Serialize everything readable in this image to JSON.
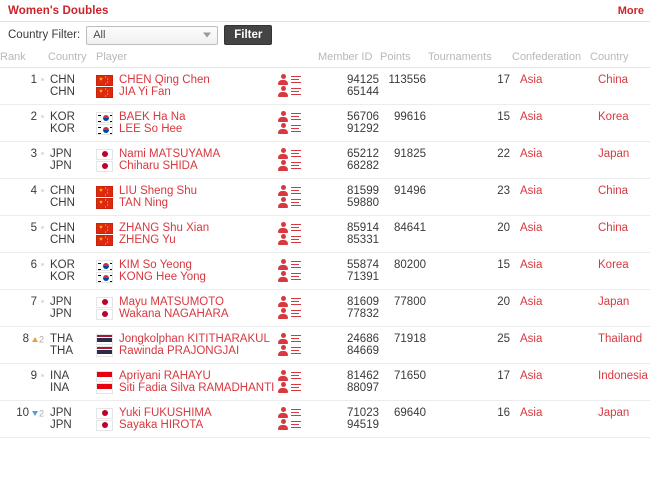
{
  "header": {
    "title": "Women's Doubles",
    "more_label": "More"
  },
  "filter": {
    "label": "Country Filter:",
    "selected_value": "All",
    "button_label": "Filter",
    "caret_icon": "chevron-down-icon"
  },
  "columns": {
    "rank": "Rank",
    "country": "Country",
    "player": "Player",
    "member_id": "Member ID",
    "points": "Points",
    "tournaments": "Tournaments",
    "confederation": "Confederation",
    "country_full": "Country"
  },
  "icons": {
    "profile": "person-icon",
    "details": "list-icon"
  },
  "rows": [
    {
      "rank": "1",
      "move_dir": "same",
      "move_value": "",
      "points": "113556",
      "tournaments": "17",
      "confederation": "Asia",
      "country_full": "China",
      "players": [
        {
          "country_code": "CHN",
          "flag": "CHN",
          "name": "CHEN Qing Chen",
          "member_id": "94125"
        },
        {
          "country_code": "CHN",
          "flag": "CHN",
          "name": "JIA Yi Fan",
          "member_id": "65144"
        }
      ]
    },
    {
      "rank": "2",
      "move_dir": "same",
      "move_value": "",
      "points": "99616",
      "tournaments": "15",
      "confederation": "Asia",
      "country_full": "Korea",
      "players": [
        {
          "country_code": "KOR",
          "flag": "KOR",
          "name": "BAEK Ha Na",
          "member_id": "56706"
        },
        {
          "country_code": "KOR",
          "flag": "KOR",
          "name": "LEE So Hee",
          "member_id": "91292"
        }
      ]
    },
    {
      "rank": "3",
      "move_dir": "same",
      "move_value": "",
      "points": "91825",
      "tournaments": "22",
      "confederation": "Asia",
      "country_full": "Japan",
      "players": [
        {
          "country_code": "JPN",
          "flag": "JPN",
          "name": "Nami MATSUYAMA",
          "member_id": "65212"
        },
        {
          "country_code": "JPN",
          "flag": "JPN",
          "name": "Chiharu SHIDA",
          "member_id": "68282"
        }
      ]
    },
    {
      "rank": "4",
      "move_dir": "same",
      "move_value": "",
      "points": "91496",
      "tournaments": "23",
      "confederation": "Asia",
      "country_full": "China",
      "players": [
        {
          "country_code": "CHN",
          "flag": "CHN",
          "name": "LIU Sheng Shu",
          "member_id": "81599"
        },
        {
          "country_code": "CHN",
          "flag": "CHN",
          "name": "TAN Ning",
          "member_id": "59880"
        }
      ]
    },
    {
      "rank": "5",
      "move_dir": "same",
      "move_value": "",
      "points": "84641",
      "tournaments": "20",
      "confederation": "Asia",
      "country_full": "China",
      "players": [
        {
          "country_code": "CHN",
          "flag": "CHN",
          "name": "ZHANG Shu Xian",
          "member_id": "85914"
        },
        {
          "country_code": "CHN",
          "flag": "CHN",
          "name": "ZHENG Yu",
          "member_id": "85331"
        }
      ]
    },
    {
      "rank": "6",
      "move_dir": "same",
      "move_value": "",
      "points": "80200",
      "tournaments": "15",
      "confederation": "Asia",
      "country_full": "Korea",
      "players": [
        {
          "country_code": "KOR",
          "flag": "KOR",
          "name": "KIM So Yeong",
          "member_id": "55874"
        },
        {
          "country_code": "KOR",
          "flag": "KOR",
          "name": "KONG Hee Yong",
          "member_id": "71391"
        }
      ]
    },
    {
      "rank": "7",
      "move_dir": "same",
      "move_value": "",
      "points": "77800",
      "tournaments": "20",
      "confederation": "Asia",
      "country_full": "Japan",
      "players": [
        {
          "country_code": "JPN",
          "flag": "JPN",
          "name": "Mayu MATSUMOTO",
          "member_id": "81609"
        },
        {
          "country_code": "JPN",
          "flag": "JPN",
          "name": "Wakana NAGAHARA",
          "member_id": "77832"
        }
      ]
    },
    {
      "rank": "8",
      "move_dir": "up",
      "move_value": "2",
      "points": "71918",
      "tournaments": "25",
      "confederation": "Asia",
      "country_full": "Thailand",
      "players": [
        {
          "country_code": "THA",
          "flag": "THA",
          "name": "Jongkolphan KITITHARAKUL",
          "member_id": "24686"
        },
        {
          "country_code": "THA",
          "flag": "THA",
          "name": "Rawinda PRAJONGJAI",
          "member_id": "84669"
        }
      ]
    },
    {
      "rank": "9",
      "move_dir": "same",
      "move_value": "",
      "points": "71650",
      "tournaments": "17",
      "confederation": "Asia",
      "country_full": "Indonesia",
      "players": [
        {
          "country_code": "INA",
          "flag": "INA",
          "name": "Apriyani RAHAYU",
          "member_id": "81462"
        },
        {
          "country_code": "INA",
          "flag": "INA",
          "name": "Siti Fadia Silva RAMADHANTI",
          "member_id": "88097"
        }
      ]
    },
    {
      "rank": "10",
      "move_dir": "down",
      "move_value": "2",
      "points": "69640",
      "tournaments": "16",
      "confederation": "Asia",
      "country_full": "Japan",
      "players": [
        {
          "country_code": "JPN",
          "flag": "JPN",
          "name": "Yuki FUKUSHIMA",
          "member_id": "71023"
        },
        {
          "country_code": "JPN",
          "flag": "JPN",
          "name": "Sayaka HIROTA",
          "member_id": "94519"
        }
      ]
    }
  ],
  "colors": {
    "accent_red": "#cc2229",
    "link_red": "#d8383f",
    "header_gray": "#b8b8b8",
    "text_dark": "#3a3a3a",
    "arrow_up": "#e8a33d",
    "arrow_down": "#5b9bd5"
  }
}
